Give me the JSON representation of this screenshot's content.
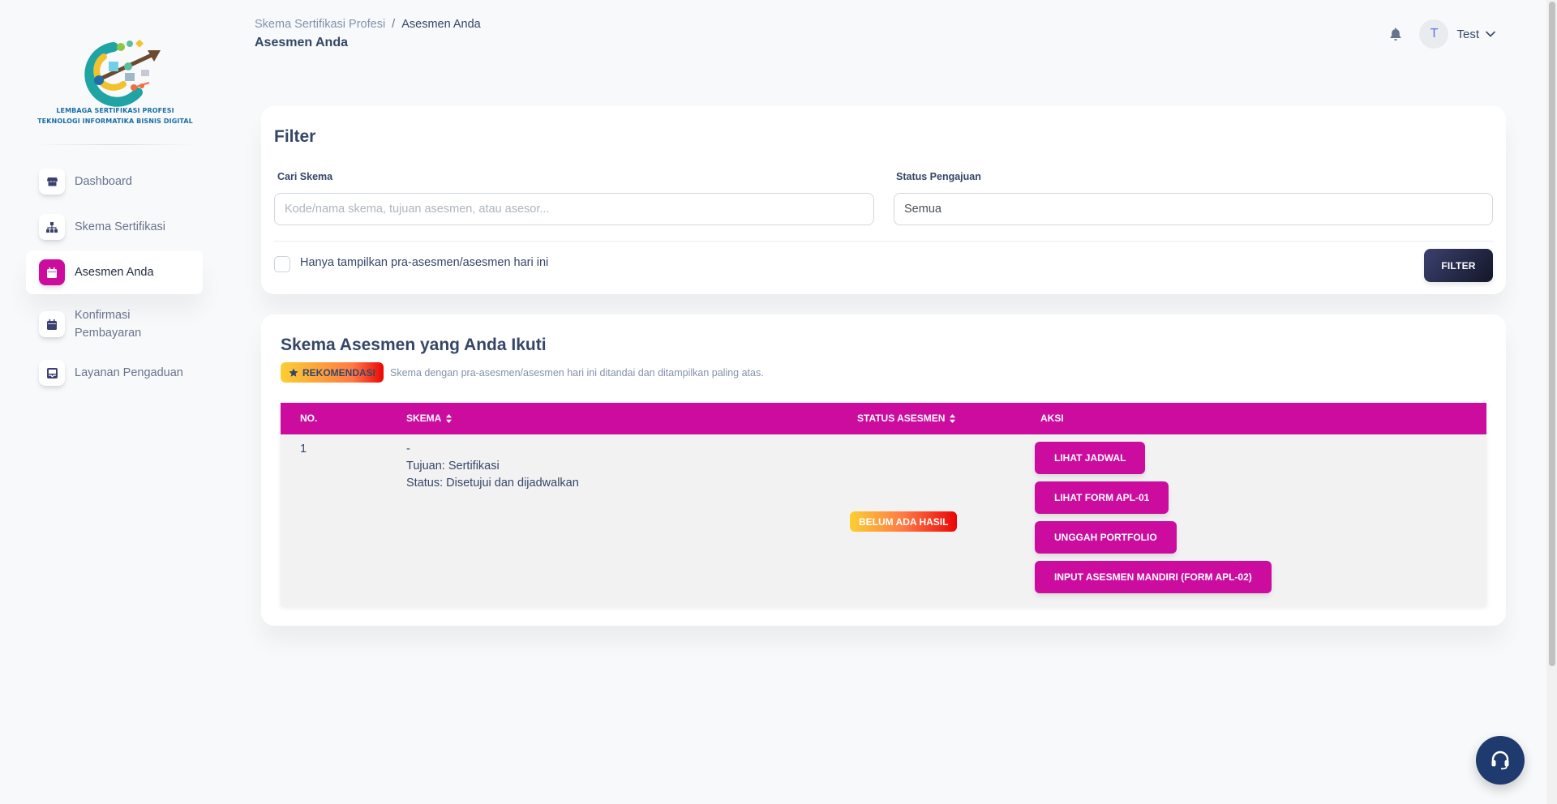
{
  "logo": {
    "line1": "LEMBAGA SERTIFIKASI PROFESI",
    "line2": "TEKNOLOGI INFORMATIKA BISNIS DIGITAL"
  },
  "sidebar": {
    "items": [
      {
        "label": "Dashboard",
        "icon": "shop-icon",
        "active": false
      },
      {
        "label": "Skema Sertifikasi",
        "icon": "sitemap-icon",
        "active": false
      },
      {
        "label": "Asesmen Anda",
        "icon": "calendar-icon",
        "active": true
      },
      {
        "label_line1": "Konfirmasi",
        "label_line2": "Pembayaran",
        "icon": "calendar-icon",
        "active": false
      },
      {
        "label": "Layanan Pengaduan",
        "icon": "inbox-icon",
        "active": false
      }
    ]
  },
  "header": {
    "breadcrumb_parent": "Skema Sertifikasi Profesi",
    "breadcrumb_sep": "/",
    "breadcrumb_current": "Asesmen Anda",
    "page_title": "Asesmen Anda",
    "user_initial": "T",
    "user_name": "Test"
  },
  "filter": {
    "title": "Filter",
    "search_label": "Cari Skema",
    "search_placeholder": "Kode/nama skema, tujuan asesmen, atau asesor...",
    "search_value": "",
    "status_label": "Status Pengajuan",
    "status_value": "Semua",
    "checkbox_label": "Hanya tampilkan pra-asesmen/asesmen hari ini",
    "checkbox_checked": false,
    "button_label": "FILTER"
  },
  "schemas": {
    "title": "Skema Asesmen yang Anda Ikuti",
    "recommend_badge": "REKOMENDASI",
    "recommend_note": "Skema dengan pra-asesmen/asesmen hari ini ditandai dan ditampilkan paling atas.",
    "columns": {
      "no": "NO.",
      "skema": "SKEMA",
      "status": "STATUS ASESMEN",
      "aksi": "AKSI"
    },
    "rows": [
      {
        "no": "1",
        "skema_name": "-",
        "tujuan": "Tujuan: Sertifikasi",
        "status_text": "Status: Disetujui dan dijadwalkan",
        "status_badge": "BELUM ADA HASIL",
        "actions": [
          "LIHAT JADWAL",
          "LIHAT FORM APL-01",
          "UNGGAH PORTFOLIO",
          "INPUT ASESMEN MANDIRI (FORM APL-02)"
        ]
      }
    ]
  },
  "colors": {
    "primary": "#cb0c9f",
    "dark_button": "#252f40",
    "fab": "#1e3a6e",
    "warning_gradient_start": "#fbcf33",
    "warning_gradient_end": "#ea0606"
  }
}
